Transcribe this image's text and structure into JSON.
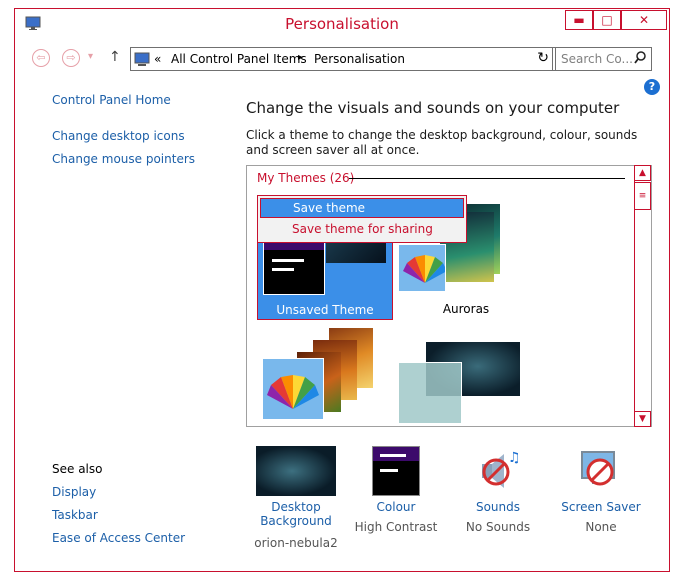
{
  "window": {
    "title": "Personalisation",
    "min_label": "▬",
    "max_label": "□",
    "close_label": "✕"
  },
  "nav": {
    "breadcrumb": [
      "«",
      "All Control Panel Items",
      "▸",
      "Personalisation"
    ],
    "search_placeholder": "Search Co..."
  },
  "sidebar": {
    "items": [
      "Control Panel Home",
      "Change desktop icons",
      "Change mouse pointers"
    ],
    "see_also_title": "See also",
    "see_also": [
      "Display",
      "Taskbar",
      "Ease of Access Center"
    ]
  },
  "main": {
    "heading": "Change the visuals and sounds on your computer",
    "description": "Click a theme to change the desktop background, colour, sounds and screen saver all at once.",
    "my_themes_label": "My Themes (26)",
    "themes": [
      {
        "name": "Unsaved Theme"
      },
      {
        "name": "Auroras"
      }
    ],
    "context_menu": [
      "Save theme",
      "Save theme for sharing"
    ]
  },
  "bottom": {
    "items": [
      {
        "label": "Desktop Background",
        "value": "orion-nebula2"
      },
      {
        "label": "Colour",
        "value": "High Contrast"
      },
      {
        "label": "Sounds",
        "value": "No Sounds"
      },
      {
        "label": "Screen Saver",
        "value": "None"
      }
    ]
  },
  "colors": {
    "accent": "#c8102e",
    "link": "#1c5fa8",
    "selection": "#3b8fe8"
  },
  "icons": {
    "help": "help-icon",
    "refresh": "refresh-icon",
    "search": "search-icon",
    "up": "up-arrow-icon"
  }
}
